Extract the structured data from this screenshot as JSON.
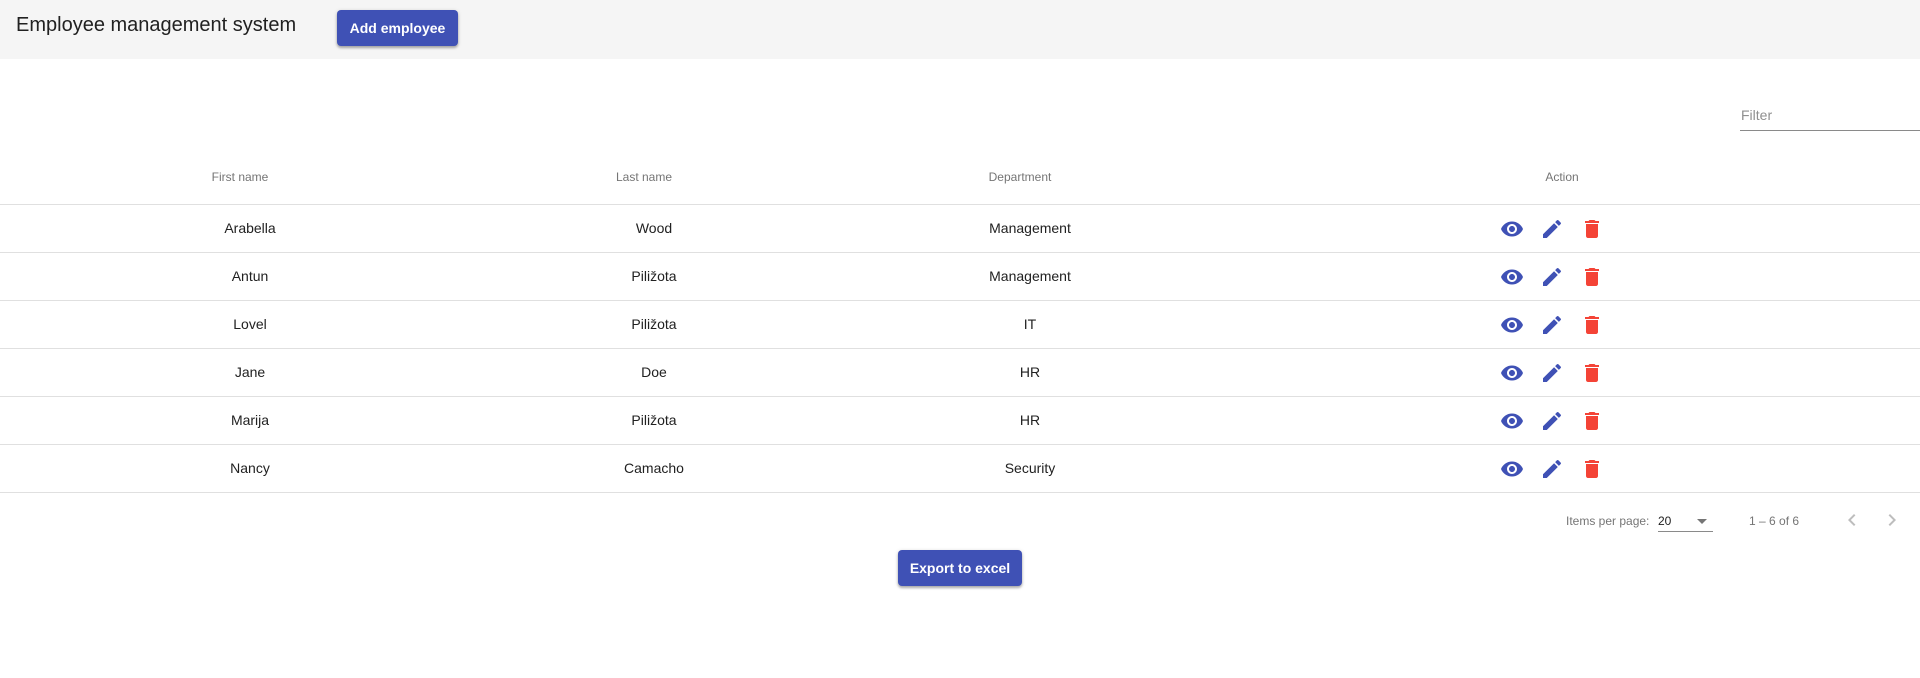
{
  "header": {
    "title": "Employee management system",
    "add_button_label": "Add employee"
  },
  "filter": {
    "placeholder": "Filter",
    "value": ""
  },
  "table": {
    "columns": {
      "first_name": "First name",
      "last_name": "Last name",
      "department": "Department",
      "action": "Action"
    },
    "rows": [
      {
        "first_name": "Arabella",
        "last_name": "Wood",
        "department": "Management"
      },
      {
        "first_name": "Antun",
        "last_name": "Piližota",
        "department": "Management"
      },
      {
        "first_name": "Lovel",
        "last_name": "Piližota",
        "department": "IT"
      },
      {
        "first_name": "Jane",
        "last_name": "Doe",
        "department": "HR"
      },
      {
        "first_name": "Marija",
        "last_name": "Piližota",
        "department": "HR"
      },
      {
        "first_name": "Nancy",
        "last_name": "Camacho",
        "department": "Security"
      }
    ],
    "action_icons": [
      "eye-icon",
      "pencil-icon",
      "trash-icon"
    ]
  },
  "paginator": {
    "items_per_page_label": "Items per page:",
    "items_per_page_value": "20",
    "range_label": "1 – 6 of 6"
  },
  "footer": {
    "export_button_label": "Export to excel"
  },
  "colors": {
    "primary": "#3f51b5",
    "danger": "#f44336",
    "toolbar_bg": "#f5f5f5"
  }
}
